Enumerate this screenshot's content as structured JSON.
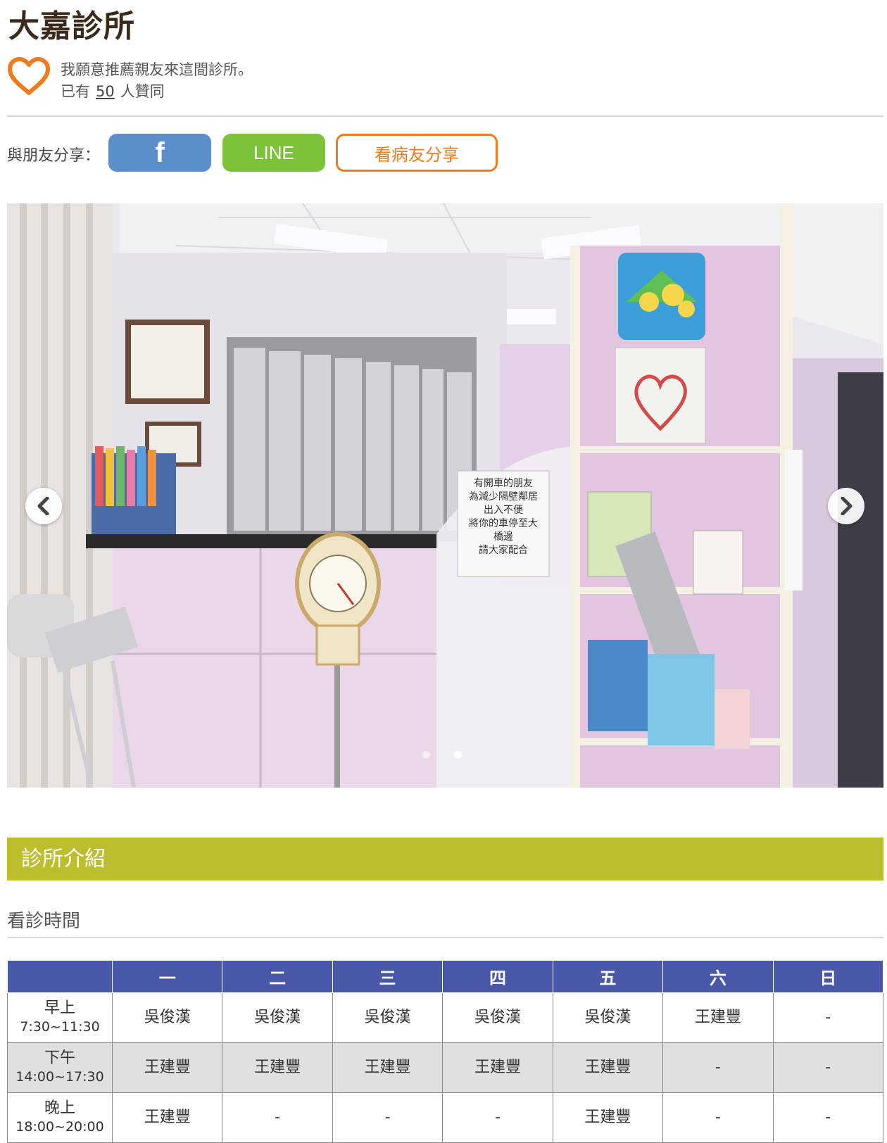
{
  "clinic": {
    "name": "大嘉診所"
  },
  "recommend": {
    "line1": "我願意推薦親友來這間診所。",
    "count_prefix": "已有",
    "count": "50",
    "count_suffix": "人贊同"
  },
  "share": {
    "label": "與朋友分享：",
    "facebook_label": "f",
    "line_label": "LINE",
    "patient_share_label": "看病友分享"
  },
  "carousel": {
    "slide_count": 2,
    "active_slide": 2,
    "photo_notice_text": [
      "有開車的朋友",
      "為減少隔壁鄰居",
      "出入不便",
      "將你的車停至大",
      "橋邊",
      "請大家配合"
    ],
    "colors": {
      "wall": "#e7d3e8",
      "counter": "#ead7ea",
      "ceiling": "#f2f2f4",
      "panel": "#e2c6e0"
    }
  },
  "section": {
    "title": "診所介紹"
  },
  "hours": {
    "title": "看診時間",
    "days": [
      "一",
      "二",
      "三",
      "四",
      "五",
      "六",
      "日"
    ],
    "rows": [
      {
        "name": "早上",
        "time": "7:30~11:30",
        "cells": [
          "吳俊漢",
          "吳俊漢",
          "吳俊漢",
          "吳俊漢",
          "吳俊漢",
          "王建豐",
          "-"
        ]
      },
      {
        "name": "下午",
        "time": "14:00~17:30",
        "cells": [
          "王建豐",
          "王建豐",
          "王建豐",
          "王建豐",
          "王建豐",
          "-",
          "-"
        ]
      },
      {
        "name": "晚上",
        "time": "18:00~20:00",
        "cells": [
          "王建豐",
          "-",
          "-",
          "-",
          "王建豐",
          "-",
          "-"
        ]
      }
    ]
  },
  "colors": {
    "heart": "#f07a1e",
    "facebook": "#5b8fcc",
    "line": "#7cc33a",
    "share_outline": "#f07a1e",
    "section_bar": "#bdbe2e",
    "table_header": "#4a59a7"
  }
}
